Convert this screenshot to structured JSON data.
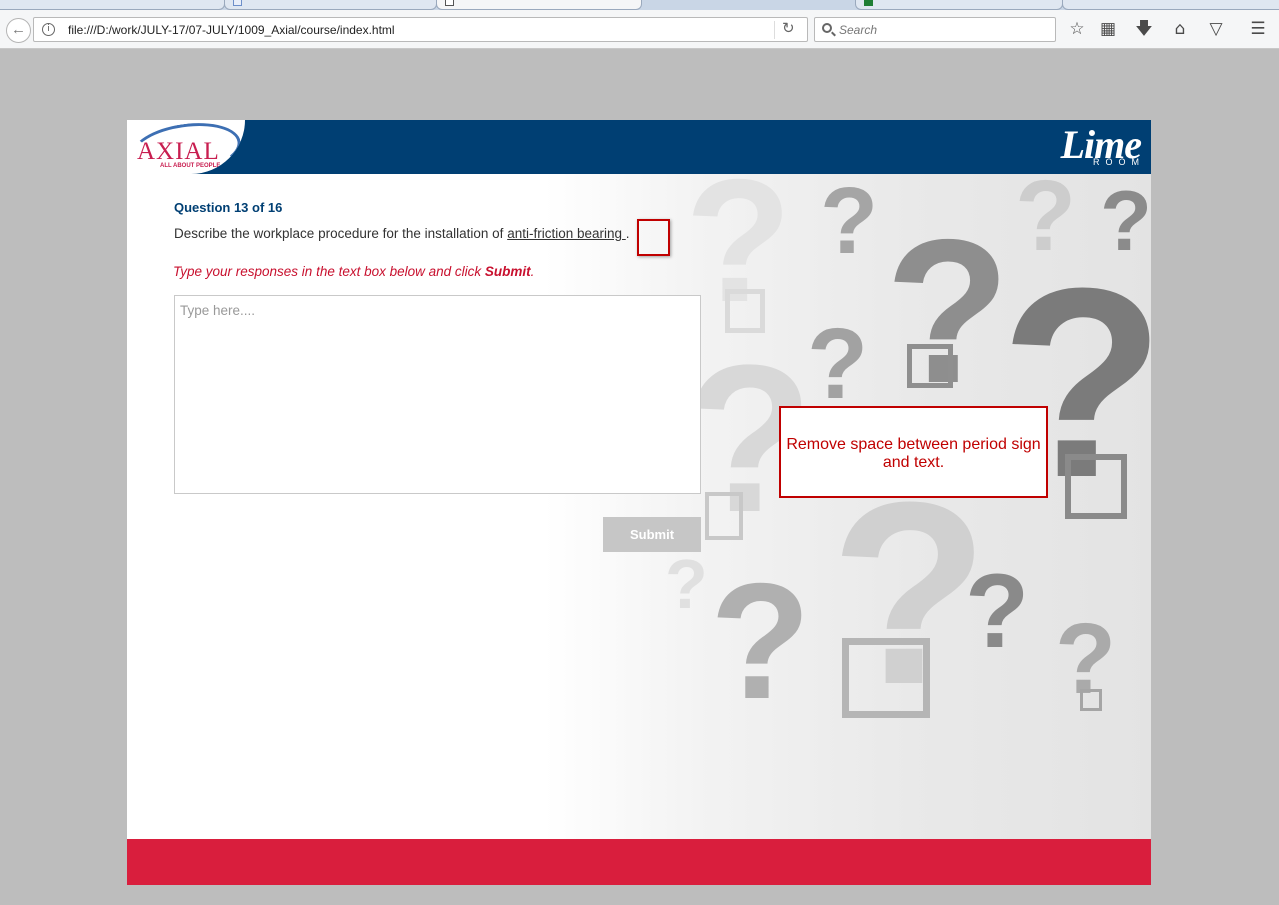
{
  "browser": {
    "url": "file:///D:/work/JULY-17/07-JULY/1009_Axial/course/index.html",
    "search_placeholder": "Search"
  },
  "header": {
    "logo_text": "AXIAL",
    "logo_tagline": "ALL ABOUT PEOPLE",
    "brand_word": "Lime",
    "brand_sub": "ROOM",
    "bar_color": "#003f73"
  },
  "question": {
    "counter": "Question 13 of 16",
    "text_before": "Describe the workplace procedure for the installation of ",
    "term": "anti-friction bearing ",
    "text_after": ".",
    "instruction_prefix": "Type your responses in the text box below and click ",
    "instruction_action": "Submit",
    "instruction_suffix": ".",
    "answer_placeholder": "Type here....",
    "answer_value": ""
  },
  "buttons": {
    "submit_label": "Submit"
  },
  "annotation": {
    "note": "Remove space between period sign and text."
  },
  "colors": {
    "accent_red": "#d91e3d",
    "note_red": "#c00000"
  }
}
